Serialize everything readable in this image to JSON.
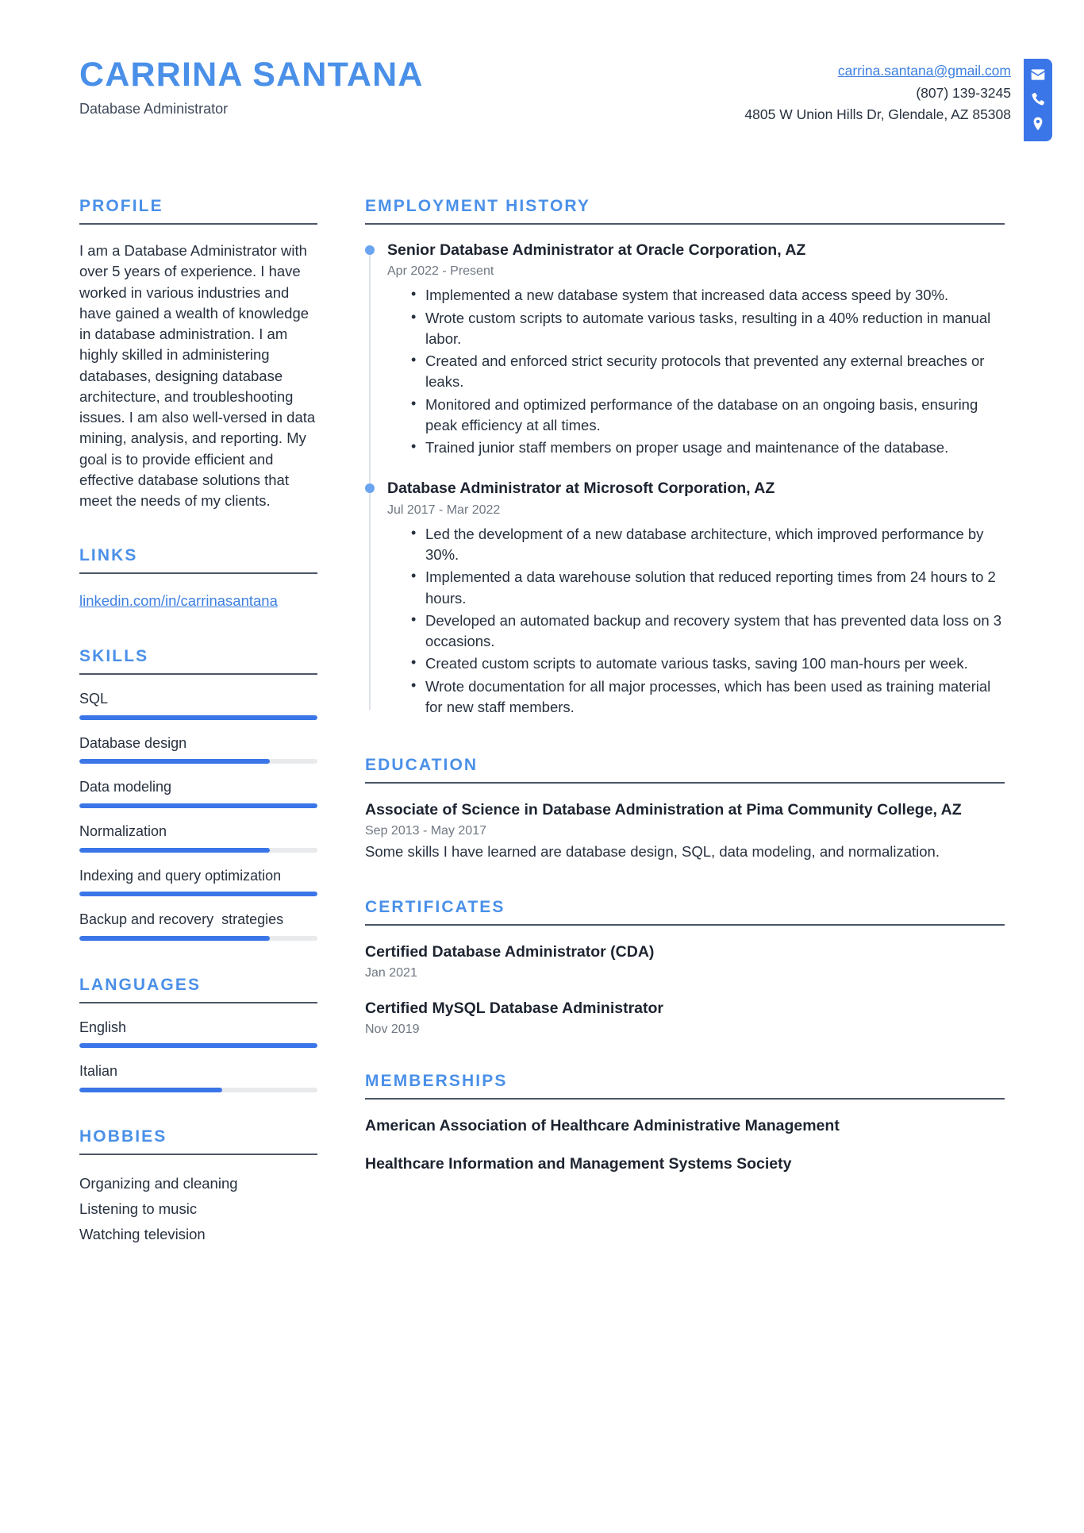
{
  "header": {
    "name": "CARRINA SANTANA",
    "title": "Database Administrator",
    "email": "carrina.santana@gmail.com",
    "phone": "(807) 139-3245",
    "address": "4805 W Union Hills Dr, Glendale, AZ 85308",
    "icons": [
      "envelope-icon",
      "phone-icon",
      "location-pin-icon"
    ],
    "accent_color": "#4a90e8",
    "icon_tab_color": "#3b76e8"
  },
  "sidebar": {
    "profile": {
      "title": "PROFILE",
      "text": "I am a Database Administrator with over 5 years of experience. I have worked in various industries and have gained a wealth of knowledge in database administration. I am highly skilled in administering databases, designing database architecture, and troubleshooting issues. I am also well-versed in data mining, analysis, and reporting. My goal is to provide efficient and effective database solutions that meet the needs of my clients."
    },
    "links": {
      "title": "LINKS",
      "items": [
        {
          "label": "linkedin.com/in/carrinasantana"
        }
      ]
    },
    "skills": {
      "title": "SKILLS",
      "items": [
        {
          "label": "SQL",
          "level": 100
        },
        {
          "label": "Database design",
          "level": 80
        },
        {
          "label": "Data modeling",
          "level": 100
        },
        {
          "label": "Normalization",
          "level": 80
        },
        {
          "label": "Indexing and query optimization",
          "level": 100
        },
        {
          "label": "Backup and recovery  strategies",
          "level": 80
        }
      ]
    },
    "languages": {
      "title": "LANGUAGES",
      "items": [
        {
          "label": "English",
          "level": 100
        },
        {
          "label": "Italian",
          "level": 60
        }
      ]
    },
    "hobbies": {
      "title": "HOBBIES",
      "items": [
        {
          "label": "Organizing and cleaning"
        },
        {
          "label": "Listening to music"
        },
        {
          "label": "Watching television"
        }
      ]
    }
  },
  "main": {
    "employment": {
      "title": "EMPLOYMENT HISTORY",
      "jobs": [
        {
          "heading": "Senior Database Administrator at Oracle Corporation, AZ",
          "dates": "Apr 2022 - Present",
          "bullets": [
            "Implemented a new database system that increased data access speed by 30%.",
            "Wrote custom scripts to automate various tasks, resulting in a 40% reduction in manual labor.",
            "Created and enforced strict security protocols that prevented any external breaches or leaks.",
            "Monitored and optimized performance of the database on an ongoing basis, ensuring peak efficiency at all times.",
            "Trained junior staff members on proper usage and maintenance of the database."
          ]
        },
        {
          "heading": "Database Administrator at Microsoft Corporation, AZ",
          "dates": "Jul 2017 - Mar 2022",
          "bullets": [
            "Led the development of a new database architecture, which improved performance by 30%.",
            "Implemented a data warehouse solution that reduced reporting times from 24 hours to 2 hours.",
            "Developed an automated backup and recovery system that has prevented data loss on 3 occasions.",
            "Created custom scripts to automate various tasks, saving 100 man-hours per week.",
            "Wrote documentation for all major processes, which has been used as training material for new staff members."
          ]
        }
      ]
    },
    "education": {
      "title": "EDUCATION",
      "entries": [
        {
          "heading": "Associate of Science in Database Administration at Pima Community College, AZ",
          "dates": "Sep 2013 - May 2017",
          "description": "Some skills I have learned are database design, SQL, data modeling, and normalization."
        }
      ]
    },
    "certificates": {
      "title": "CERTIFICATES",
      "entries": [
        {
          "heading": "Certified Database Administrator (CDA)",
          "dates": "Jan 2021"
        },
        {
          "heading": "Certified MySQL Database Administrator",
          "dates": "Nov 2019"
        }
      ]
    },
    "memberships": {
      "title": "MEMBERSHIPS",
      "items": [
        {
          "label": "American Association of Healthcare Administrative Management"
        },
        {
          "label": "Healthcare Information and Management Systems Society"
        }
      ]
    }
  }
}
